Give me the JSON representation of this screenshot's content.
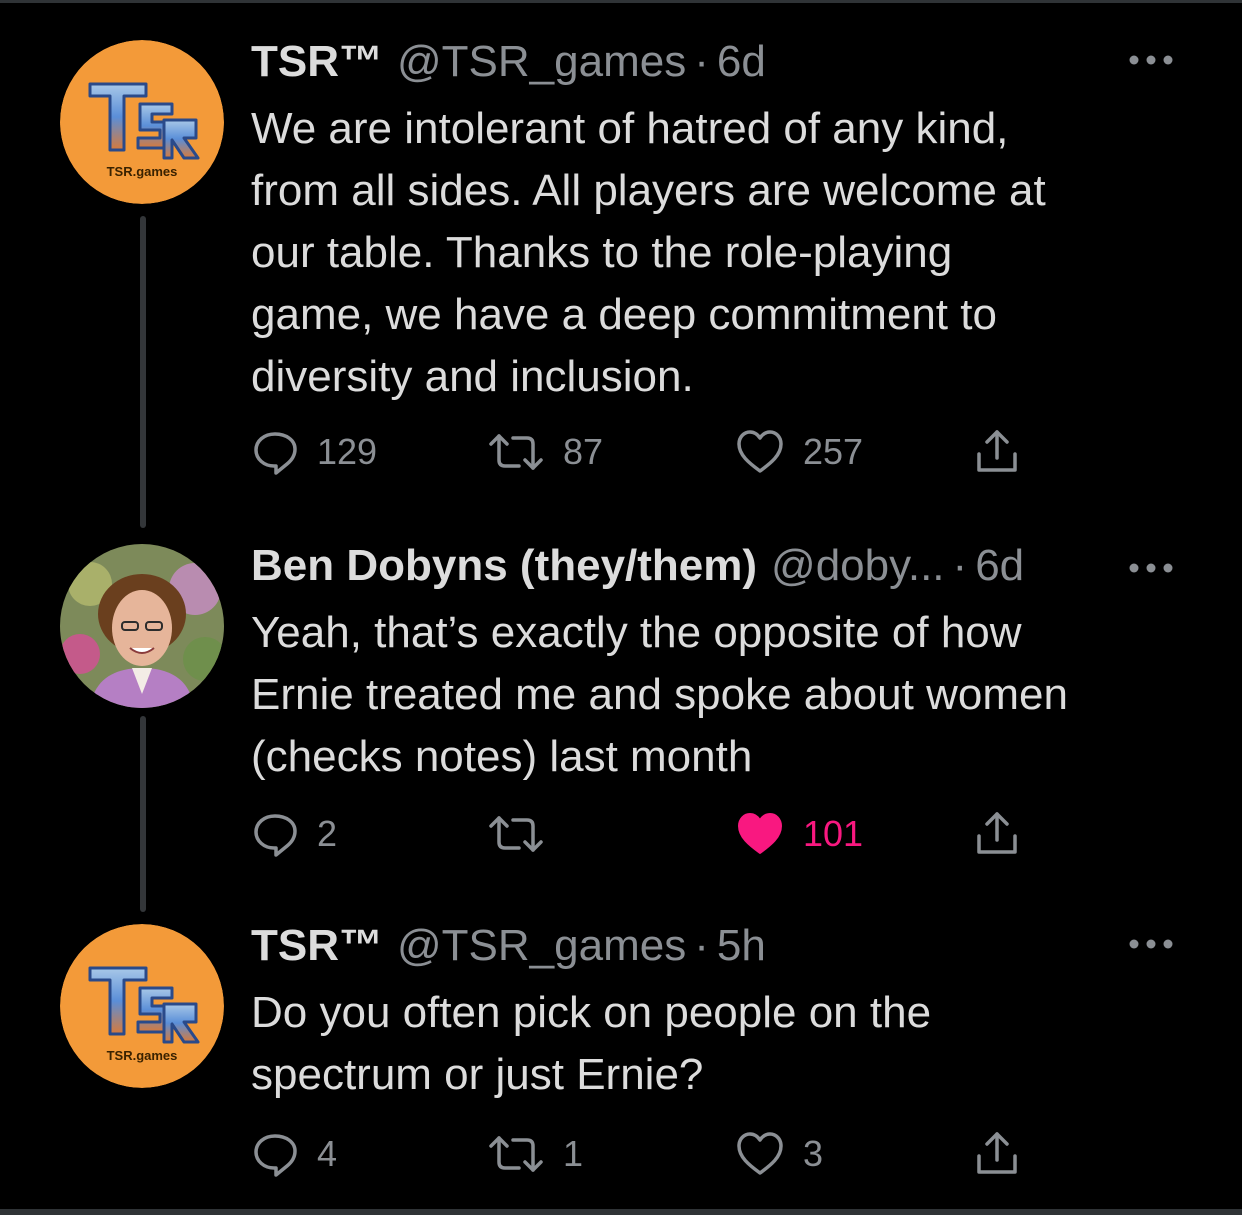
{
  "colors": {
    "background": "#000000",
    "text": "#dcdcdc",
    "muted": "#8b8f94",
    "like_active": "#f91880",
    "tsr_avatar": "#f39a39"
  },
  "tweets": [
    {
      "name": "TSR™",
      "handle": "@TSR_games",
      "separator": "·",
      "time": "6d",
      "avatar_label": "TSR.games",
      "text": "We are intolerant of hatred of any kind,\nfrom all sides. All players are welcome at\nour table. Thanks to the role-playing\ngame, we have a deep commitment to\ndiversity and inclusion.",
      "replies": "129",
      "retweets": "87",
      "likes": "257",
      "liked": false
    },
    {
      "name": "Ben Dobyns (they/them)",
      "handle": "@doby...",
      "separator": "·",
      "time": "6d",
      "text": "Yeah, that’s exactly the opposite of how\nErnie treated me and spoke about women\n(checks notes) last month",
      "replies": "2",
      "retweets": "",
      "likes": "101",
      "liked": true
    },
    {
      "name": "TSR™",
      "handle": "@TSR_games",
      "separator": "·",
      "time": "5h",
      "avatar_label": "TSR.games",
      "text": "Do you often pick on people on the\nspectrum or just Ernie?",
      "replies": "4",
      "retweets": "1",
      "likes": "3",
      "liked": false
    }
  ],
  "icons": {
    "reply": "reply-icon",
    "retweet": "retweet-icon",
    "like": "heart-icon",
    "like_active": "heart-filled-icon",
    "share": "share-icon",
    "more": "more-icon"
  }
}
